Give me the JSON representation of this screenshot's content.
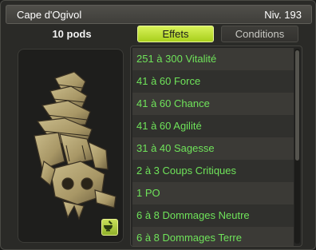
{
  "header": {
    "item_name": "Cape d'Ogivol",
    "level": "Niv. 193"
  },
  "item": {
    "weight": "10 pods",
    "image_icon": "bone-cape-icon",
    "craft_icon": "mortar-pestle-icon"
  },
  "tabs": [
    {
      "label": "Effets",
      "active": true
    },
    {
      "label": "Conditions",
      "active": false
    }
  ],
  "effects": [
    "251 à 300 Vitalité",
    "41 à 60 Force",
    "41 à 60 Chance",
    "41 à 60 Agilité",
    "31 à 40 Sagesse",
    "2 à 3 Coups Critiques",
    "1 PO",
    "6 à 8 Dommages Neutre",
    "6 à 8 Dommages Terre"
  ],
  "colors": {
    "effect_text": "#6fe35a",
    "active_tab": "#c2e33a",
    "panel_bg": "#2a2a27"
  }
}
